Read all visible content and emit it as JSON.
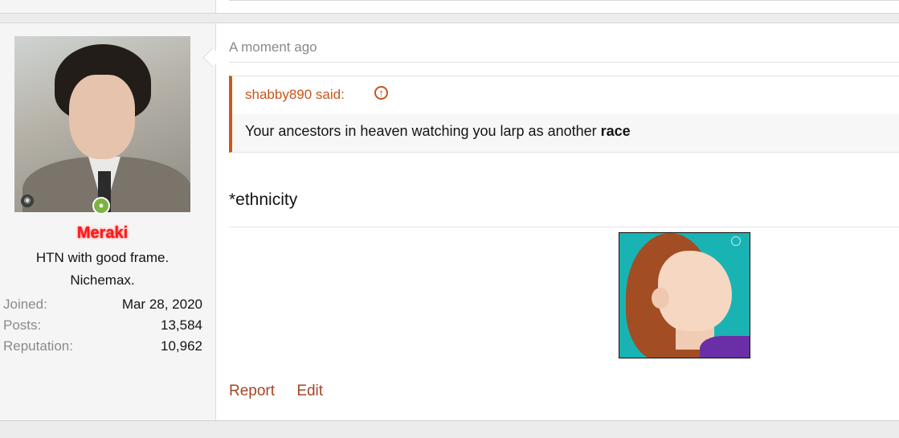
{
  "user": {
    "name": "Meraki",
    "title_lines": [
      "HTN with good frame.",
      "Nichemax."
    ],
    "stats": [
      {
        "label": "Joined:",
        "value": "Mar 28, 2020"
      },
      {
        "label": "Posts:",
        "value": "13,584"
      },
      {
        "label": "Reputation:",
        "value": "10,962"
      }
    ],
    "online_icon": "user-online-icon",
    "avatar_icon": "camera-icon"
  },
  "post": {
    "timestamp": "A moment ago",
    "quote": {
      "author": "shabby890 said:",
      "text_before": "Your ancestors in heaven watching you larp as another ",
      "text_bold": "race",
      "up_icon": "arrow-up-circle-icon"
    },
    "body": "*ethnicity",
    "actions": {
      "report": "Report",
      "edit": "Edit"
    }
  },
  "colors": {
    "username": "#ff1a1a",
    "quote_accent": "#c85a1b",
    "action_link": "#a64425"
  }
}
